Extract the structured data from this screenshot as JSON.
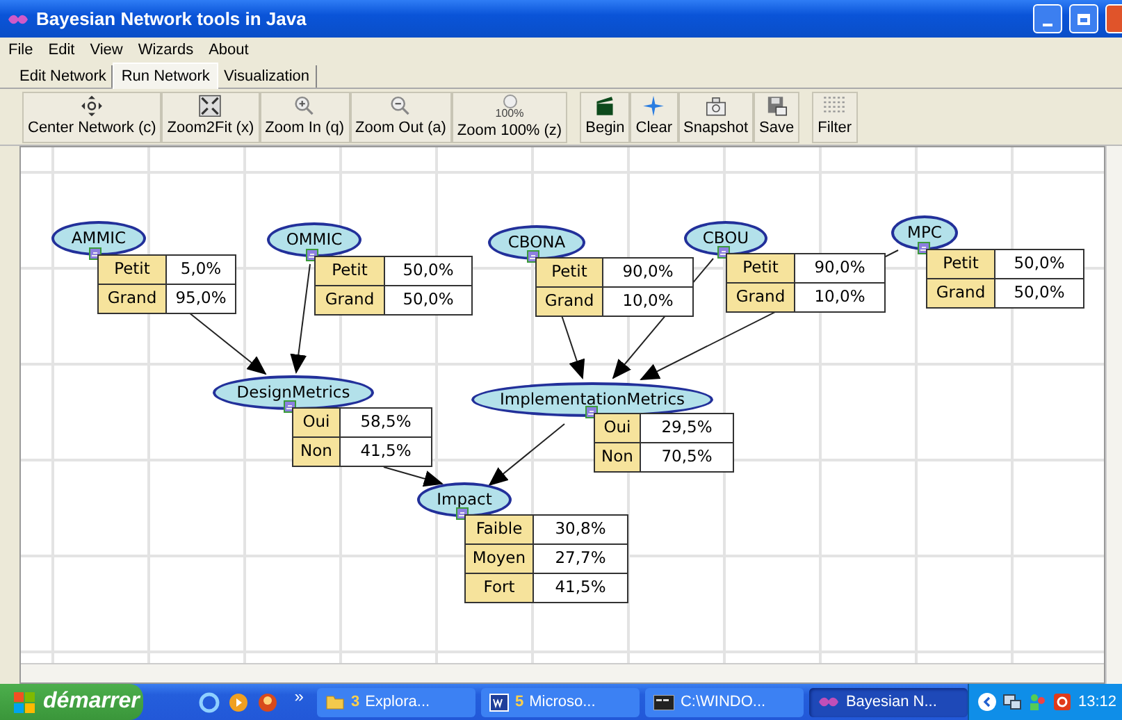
{
  "window": {
    "title": "Bayesian Network tools in Java"
  },
  "menu": [
    "File",
    "Edit",
    "View",
    "Wizards",
    "About"
  ],
  "tabs": [
    {
      "label": "Edit Network",
      "selected": false
    },
    {
      "label": "Run Network",
      "selected": true
    },
    {
      "label": "Visualization",
      "selected": false
    }
  ],
  "toolbar": {
    "groups": [
      [
        {
          "label": "Center Network (c)"
        },
        {
          "label": "Zoom2Fit (x)"
        },
        {
          "label": "Zoom In (q)"
        },
        {
          "label": "Zoom Out (a)"
        },
        {
          "label": "Zoom 100% (z)",
          "icon_text": "100%"
        }
      ],
      [
        {
          "label": "Begin"
        },
        {
          "label": "Clear"
        },
        {
          "label": "Snapshot"
        },
        {
          "label": "Save"
        }
      ],
      [
        {
          "label": "Filter"
        }
      ]
    ]
  },
  "nodes": [
    {
      "name": "AMMIC",
      "states": [
        {
          "label": "Petit",
          "value": "5,0%"
        },
        {
          "label": "Grand",
          "value": "95,0%"
        }
      ]
    },
    {
      "name": "OMMIC",
      "states": [
        {
          "label": "Petit",
          "value": "50,0%"
        },
        {
          "label": "Grand",
          "value": "50,0%"
        }
      ]
    },
    {
      "name": "CBONA",
      "states": [
        {
          "label": "Petit",
          "value": "90,0%"
        },
        {
          "label": "Grand",
          "value": "10,0%"
        }
      ]
    },
    {
      "name": "CBOU",
      "states": [
        {
          "label": "Petit",
          "value": "90,0%"
        },
        {
          "label": "Grand",
          "value": "10,0%"
        }
      ]
    },
    {
      "name": "MPC",
      "states": [
        {
          "label": "Petit",
          "value": "50,0%"
        },
        {
          "label": "Grand",
          "value": "50,0%"
        }
      ]
    },
    {
      "name": "DesignMetrics",
      "states": [
        {
          "label": "Oui",
          "value": "58,5%"
        },
        {
          "label": "Non",
          "value": "41,5%"
        }
      ]
    },
    {
      "name": "ImplementationMetrics",
      "states": [
        {
          "label": "Oui",
          "value": "29,5%"
        },
        {
          "label": "Non",
          "value": "70,5%"
        }
      ]
    },
    {
      "name": "Impact",
      "states": [
        {
          "label": "Faible",
          "value": "30,8%"
        },
        {
          "label": "Moyen",
          "value": "27,7%"
        },
        {
          "label": "Fort",
          "value": "41,5%"
        }
      ]
    }
  ],
  "taskbar": {
    "start": "démarrer",
    "chevron": "»",
    "tasks": [
      {
        "count": "3",
        "label": "Explora...",
        "selected": false,
        "kind": "folder"
      },
      {
        "count": "5",
        "label": "Microso...",
        "selected": false,
        "kind": "word"
      },
      {
        "label": "C:\\WINDO...",
        "selected": false,
        "kind": "console"
      },
      {
        "label": "Bayesian N...",
        "selected": true,
        "kind": "java"
      }
    ],
    "clock": "13:12"
  }
}
